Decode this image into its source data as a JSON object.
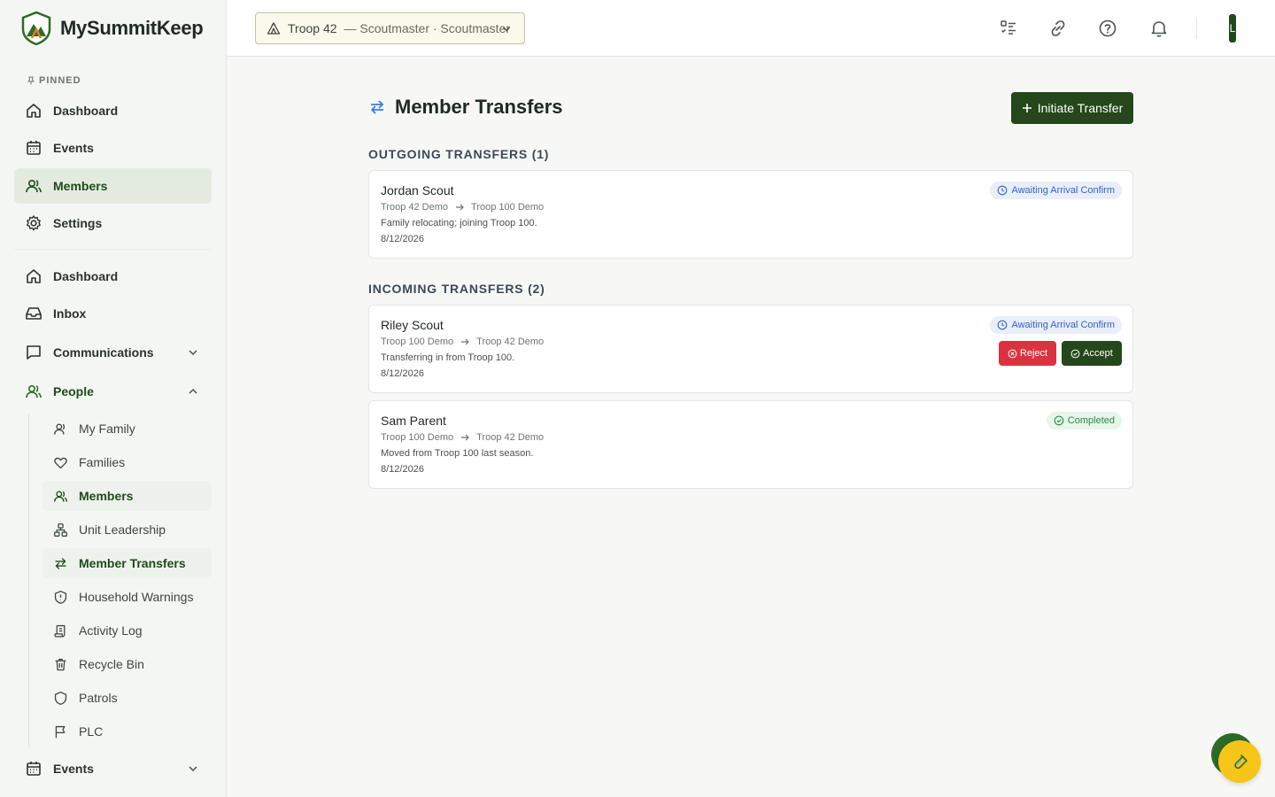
{
  "brand": {
    "name": "MySummitKeep"
  },
  "sidebar": {
    "pinned_label": "PINNED",
    "pinned": [
      {
        "label": "Dashboard",
        "icon": "home-icon"
      },
      {
        "label": "Events",
        "icon": "calendar-icon"
      },
      {
        "label": "Members",
        "icon": "users-icon",
        "active": true
      },
      {
        "label": "Settings",
        "icon": "gear-icon"
      }
    ],
    "main": [
      {
        "label": "Dashboard",
        "icon": "home-icon"
      },
      {
        "label": "Inbox",
        "icon": "inbox-icon"
      },
      {
        "label": "Communications",
        "icon": "message-icon",
        "expanded": false
      },
      {
        "label": "People",
        "icon": "users-icon",
        "expanded": true
      }
    ],
    "people_sub": [
      {
        "label": "My Family",
        "icon": "user-icon"
      },
      {
        "label": "Families",
        "icon": "heart-icon"
      },
      {
        "label": "Members",
        "icon": "users-icon",
        "active": true
      },
      {
        "label": "Unit Leadership",
        "icon": "org-chart-icon"
      },
      {
        "label": "Member Transfers",
        "icon": "transfer-icon",
        "active": true
      },
      {
        "label": "Household Warnings",
        "icon": "shield-alert-icon"
      },
      {
        "label": "Activity Log",
        "icon": "scroll-icon"
      },
      {
        "label": "Recycle Bin",
        "icon": "trash-icon"
      },
      {
        "label": "Patrols",
        "icon": "shield-icon"
      },
      {
        "label": "PLC",
        "icon": "flag-icon"
      }
    ],
    "events_bottom": {
      "label": "Events",
      "icon": "calendar-icon"
    }
  },
  "header": {
    "troop_name": "Troop 42",
    "troop_role": "— Scoutmaster · Scoutmaster",
    "avatar_initial": "L"
  },
  "page": {
    "title": "Member Transfers",
    "initiate_label": "Initiate Transfer"
  },
  "outgoing": {
    "title": "OUTGOING TRANSFERS (1)",
    "items": [
      {
        "name": "Jordan Scout",
        "from": "Troop 42 Demo",
        "to": "Troop 100 Demo",
        "note": "Family relocating; joining Troop 100.",
        "date": "8/12/2026",
        "status": "Awaiting Arrival Confirm"
      }
    ]
  },
  "incoming": {
    "title": "INCOMING TRANSFERS (2)",
    "items": [
      {
        "name": "Riley Scout",
        "from": "Troop 100 Demo",
        "to": "Troop 42 Demo",
        "note": "Transferring in from Troop 100.",
        "date": "8/12/2026",
        "status": "Awaiting Arrival Confirm",
        "reject_label": "Reject",
        "accept_label": "Accept"
      },
      {
        "name": "Sam Parent",
        "from": "Troop 100 Demo",
        "to": "Troop 42 Demo",
        "note": "Moved from Troop 100 last season.",
        "date": "8/12/2026",
        "status": "Completed"
      }
    ]
  },
  "colors": {
    "brand_green": "#24471b",
    "reject_red": "#d93340",
    "awaiting_blue": "#3762c8",
    "completed_green": "#2d8a48"
  }
}
